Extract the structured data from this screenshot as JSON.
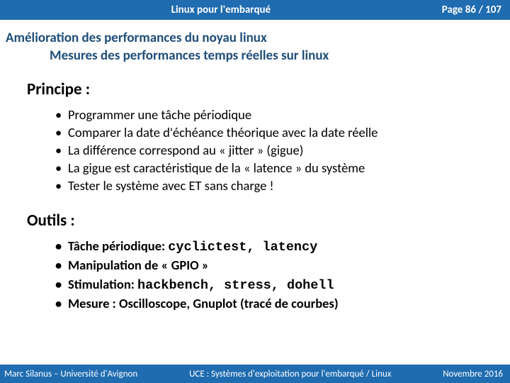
{
  "topbar": {
    "title": "Linux pour l'embarqué",
    "page": "Page 86 / 107"
  },
  "heading": "Amélioration des performances du noyau linux",
  "subheading": "Mesures des performances temps réelles sur linux",
  "section1": {
    "title": "Principe :",
    "items": [
      "Programmer une tâche périodique",
      "Comparer la date d'échéance théorique avec la date réelle",
      "La différence correspond au « jitter » (gigue)",
      "La gigue est caractéristique de la « latence » du système",
      "Tester le système avec ET sans charge !"
    ]
  },
  "section2": {
    "title": "Outils :",
    "items": [
      {
        "label": "Tâche périodique: ",
        "code": "cyclictest, latency"
      },
      {
        "label": "Manipulation de « GPIO »",
        "code": ""
      },
      {
        "label": "Stimulation: ",
        "code": "hackbench, stress, dohell"
      },
      {
        "label": "Mesure : Oscilloscope, Gnuplot (tracé de courbes)",
        "code": ""
      }
    ]
  },
  "footer": {
    "left": "Marc Silanus – Université d'Avignon",
    "mid": "UCE : Systèmes d'exploitation pour l'embarqué / Linux",
    "right": "Novembre 2016"
  }
}
